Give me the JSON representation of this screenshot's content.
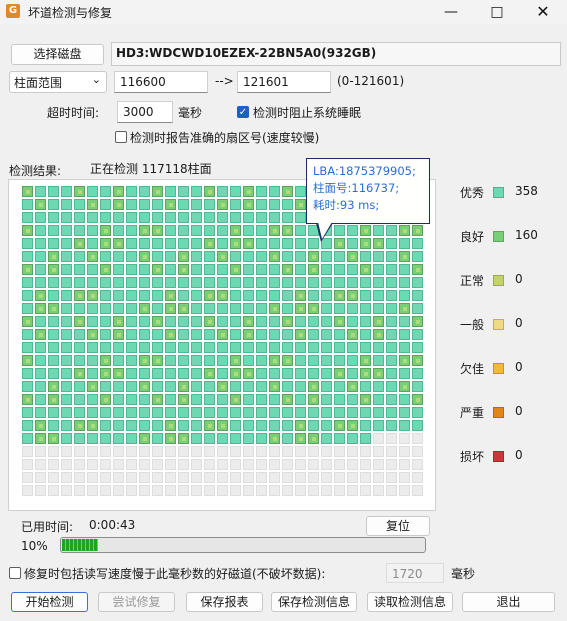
{
  "window": {
    "title": "坏道检测与修复",
    "icon_label": "G",
    "controls": [
      "minimize-icon",
      "maximize-icon",
      "close-icon"
    ]
  },
  "disk": {
    "select_button": "选择磁盘",
    "name": "HD3:WDCWD10EZEX-22BN5A0(932GB)"
  },
  "range": {
    "mode": "柱面范围",
    "start": "116600",
    "arrow": "-->",
    "end": "121601",
    "total": "(0-121601)"
  },
  "options": {
    "timeout_label": "超时时间:",
    "timeout_value": "3000",
    "timeout_unit": "毫秒",
    "prevent_sleep_label": "检测时阻止系统睡眠",
    "prevent_sleep_checked": true,
    "report_sector_label": "检测时报告准确的扇区号(速度较慢)",
    "report_sector_checked": false
  },
  "result": {
    "label": "检测结果:",
    "status": "正在检测 117118柱面"
  },
  "grid": {
    "columns": 31,
    "rows": 24,
    "filled_rows": 19,
    "partial_row_filled": 27
  },
  "tooltip": {
    "lines": [
      "LBA:1875379905;",
      "柱面号:116737;",
      "耗时:93 ms;"
    ]
  },
  "legend": [
    {
      "label": "优秀",
      "color": "#6ed8b3",
      "count": "358"
    },
    {
      "label": "良好",
      "color": "#79cf78",
      "count": "160"
    },
    {
      "label": "正常",
      "color": "#c3d26a",
      "count": "0"
    },
    {
      "label": "一般",
      "color": "#f0d983",
      "count": "0"
    },
    {
      "label": "欠佳",
      "color": "#f2b93b",
      "count": "0"
    },
    {
      "label": "严重",
      "color": "#e0861b",
      "count": "0"
    },
    {
      "label": "损坏",
      "color": "#c8373b",
      "count": "0"
    }
  ],
  "timing": {
    "elapsed_label": "已用时间:",
    "elapsed_value": "0:00:43",
    "reset_button": "复位",
    "percent": "10%",
    "progress": 0.1
  },
  "repair": {
    "label": "修复时包括读写速度慢于此毫秒数的好磁道(不破坏数据):",
    "checked": false,
    "value": "1720",
    "unit": "毫秒"
  },
  "buttons": {
    "start": "开始检测",
    "try_repair": "尝试修复",
    "save_report": "保存报表",
    "save_info": "保存检测信息",
    "read_info": "读取检测信息",
    "exit": "退出"
  }
}
